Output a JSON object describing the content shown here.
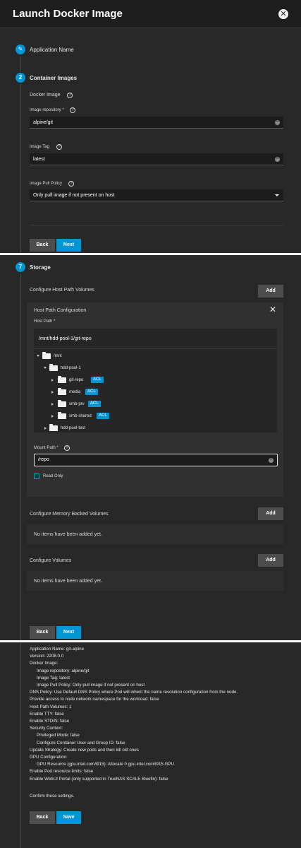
{
  "header": {
    "title": "Launch Docker Image"
  },
  "steps": {
    "application_name": "Application Name",
    "container_images": {
      "number": "2",
      "label": "Container Images"
    },
    "storage": {
      "number": "7",
      "label": "Storage"
    }
  },
  "container_images": {
    "docker_image_label": "Docker Image",
    "image_repository_label": "Image repository *",
    "image_repository_value": "alpine/git",
    "image_tag_label": "Image Tag",
    "image_tag_value": "latest",
    "pull_policy_label": "Image Pull Policy",
    "pull_policy_value": "Only pull image if not present on host"
  },
  "buttons": {
    "back": "Back",
    "next": "Next",
    "add": "Add",
    "save": "Save"
  },
  "storage": {
    "host_path_volumes_label": "Configure Host Path Volumes",
    "host_path_config_title": "Host Path Configuration",
    "host_path_label": "Host Path *",
    "host_path_value": "/mnt/hdd-pool-1/git-repo",
    "tree": [
      {
        "name": "/mnt",
        "expanded": true,
        "depth": 0,
        "acl": false
      },
      {
        "name": "hdd-pool-1",
        "expanded": true,
        "depth": 1,
        "acl": false
      },
      {
        "name": "git-repo",
        "expanded": false,
        "depth": 2,
        "acl": true
      },
      {
        "name": "media",
        "expanded": false,
        "depth": 2,
        "acl": true
      },
      {
        "name": "smb-prv",
        "expanded": false,
        "depth": 2,
        "acl": true
      },
      {
        "name": "smb-shared",
        "expanded": false,
        "depth": 2,
        "acl": true
      },
      {
        "name": "hdd-pool-test",
        "expanded": false,
        "depth": 1,
        "acl": false
      }
    ],
    "acl_label": "ACL",
    "mount_path_label": "Mount Path *",
    "mount_path_value": "/repo",
    "read_only_label": "Read Only",
    "memory_volumes_label": "Configure Memory Backed Volumes",
    "memory_volumes_empty": "No items have been added yet.",
    "volumes_label": "Configure Volumes",
    "volumes_empty": "No items have been added yet."
  },
  "summary": {
    "lines": [
      {
        "text": "Application Name: git-alpine",
        "indent": 0
      },
      {
        "text": "Version: 2208.0.0",
        "indent": 0
      },
      {
        "text": "Docker Image:",
        "indent": 0
      },
      {
        "text": "Image repository: alpine/git",
        "indent": 1
      },
      {
        "text": "Image Tag: latest",
        "indent": 1
      },
      {
        "text": "Image Pull Policy: Only pull image if not present on host",
        "indent": 1
      },
      {
        "text": "DNS Policy: Use Default DNS Policy where Pod will inherit the name resolution configuration from the node.",
        "indent": 0
      },
      {
        "text": "Provide access to node network namespace for the workload: false",
        "indent": 0
      },
      {
        "text": "Host Path Volumes: 1",
        "indent": 0
      },
      {
        "text": "Enable TTY: false",
        "indent": 0
      },
      {
        "text": "Enable STDIN: false",
        "indent": 0
      },
      {
        "text": "Security Context:",
        "indent": 0
      },
      {
        "text": "Privileged Mode: false",
        "indent": 1
      },
      {
        "text": "Configure Container User and Group ID: false",
        "indent": 1
      },
      {
        "text": "Update Strategy: Create new pods and then kill old ones",
        "indent": 0
      },
      {
        "text": "GPU Configuration:",
        "indent": 0
      },
      {
        "text": "GPU Resource (gpu.intel.com/i915): Allocate 0 gpu.intel.com/i915 GPU",
        "indent": 1
      },
      {
        "text": "Enable Pod resource limits: false",
        "indent": 0
      },
      {
        "text": "Enable WebUI Portal (only supported in TrueNAS SCALE Bluefin): false",
        "indent": 0
      }
    ],
    "confirm": "Confirm these settings."
  },
  "colors": {
    "accent": "#0095d5",
    "panel": "#282828",
    "header": "#1e1e1e"
  }
}
